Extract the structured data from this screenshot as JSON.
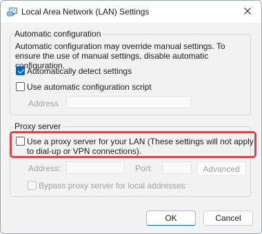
{
  "window": {
    "title": "Local Area Network (LAN) Settings",
    "icon": "network-globe-icon"
  },
  "automatic": {
    "legend": "Automatic configuration",
    "description": "Automatic configuration may override manual settings.  To ensure the use of manual settings, disable automatic configuration.",
    "detect": {
      "label": "Automatically detect settings",
      "checked": true
    },
    "script": {
      "label": "Use automatic configuration script",
      "checked": false
    },
    "address_label": "Address",
    "address_value": ""
  },
  "proxy": {
    "legend": "Proxy server",
    "use_proxy": {
      "label": "Use a proxy server for your LAN (These settings will not apply to dial-up or VPN connections).",
      "checked": false
    },
    "address_label": "Address:",
    "address_value": "",
    "port_label": "Port:",
    "port_value": "",
    "advanced_label": "Advanced",
    "bypass": {
      "label": "Bypass proxy server for local addresses",
      "checked": false
    }
  },
  "buttons": {
    "ok": "OK",
    "cancel": "Cancel"
  },
  "colors": {
    "accent": "#0067c0",
    "highlight": "#d9434b"
  }
}
